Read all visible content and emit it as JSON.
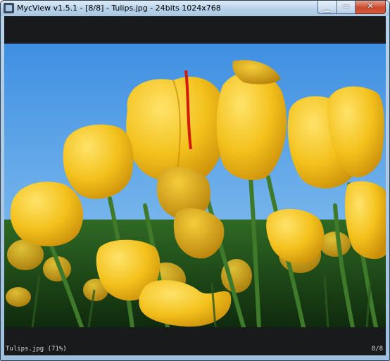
{
  "window": {
    "title": "MycView v1.5.1 - [8/8] - Tulips.jpg - 24bits  1024x768",
    "controls": {
      "minimize": "▁",
      "maximize": "▭",
      "close": "✕"
    }
  },
  "viewer": {
    "image_alt": "Tulips.jpg"
  },
  "status": {
    "left": "Tulips.jpg (71%)",
    "right": "8/8"
  },
  "colors": {
    "sky": "#4d9ae6",
    "petal": "#f2c21f",
    "stem": "#3f7a2a",
    "background": "#191a1c"
  },
  "icons": [
    "app-icon",
    "minimize-icon",
    "maximize-icon",
    "close-icon"
  ]
}
